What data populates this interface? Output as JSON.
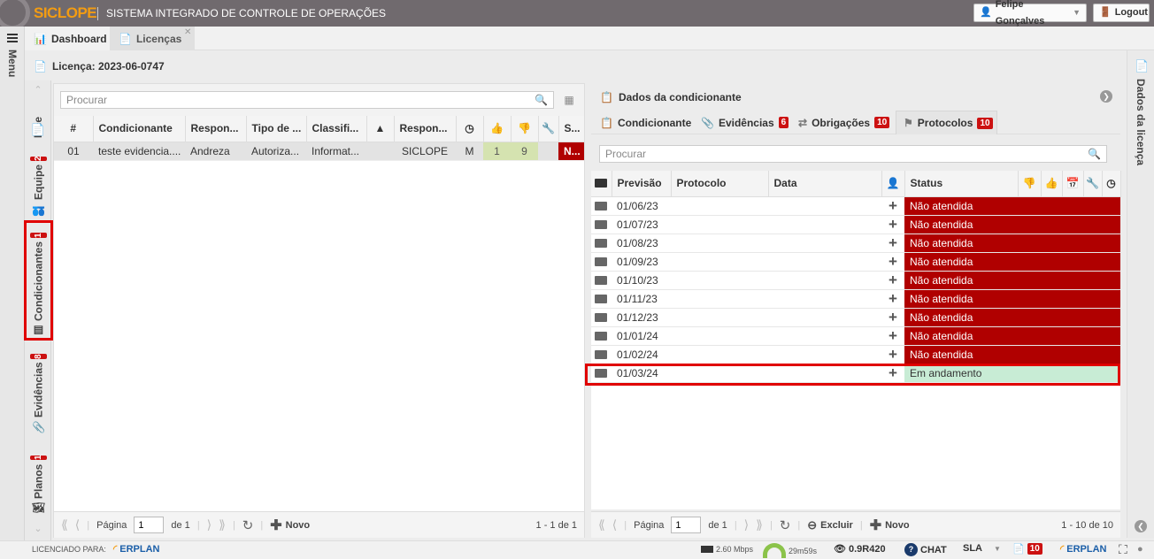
{
  "app": {
    "logo": "SICLOPE",
    "title": "SISTEMA INTEGRADO DE CONTROLE DE OPERAÇÕES"
  },
  "user": {
    "name": "Felipe Gonçalves",
    "logout": "Logout"
  },
  "tabs": {
    "dashboard": "Dashboard",
    "licencas": "Licenças"
  },
  "menu": {
    "label": "Menu"
  },
  "page": {
    "title": "Licença: 2023-06-0747"
  },
  "left_tabs": {
    "lice": "Lice",
    "equipe": "Equipe",
    "equipe_badge": "2",
    "condicionantes": "Condicionantes",
    "condicionantes_badge": "1",
    "evidencias": "Evidências",
    "evidencias_badge": "8",
    "planos": "Planos",
    "planos_badge": "1"
  },
  "left": {
    "search_placeholder": "Procurar",
    "columns": [
      "#",
      "Condicionante",
      "Respon...",
      "Tipo de ...",
      "Classifi...",
      "",
      "Respon...",
      "",
      "",
      "",
      "",
      "S..."
    ],
    "rows": [
      {
        "num": "01",
        "condicionante": "teste evidencia....",
        "responsavel": "Andreza",
        "tipo": "Autoriza...",
        "classificacao": "Informat...",
        "resp2": "SICLOPE",
        "freq": "M",
        "likes": "1",
        "dislikes": "9",
        "status": "N..."
      }
    ],
    "pager": {
      "pagina": "Página",
      "page": "1",
      "de": "de 1",
      "novo": "Novo",
      "range": "1 - 1 de 1"
    }
  },
  "right": {
    "header": "Dados da condicionante",
    "tabs": {
      "condicionante": "Condicionante",
      "evidencias": "Evidências",
      "evidencias_badge": "6",
      "obrigacoes": "Obrigações",
      "obrigacoes_badge": "10",
      "protocolos": "Protocolos",
      "protocolos_badge": "10"
    },
    "search_placeholder": "Procurar",
    "columns": {
      "previsao": "Previsão",
      "protocolo": "Protocolo",
      "data": "Data",
      "status": "Status"
    },
    "rows": [
      {
        "previsao": "01/06/23",
        "status": "Não atendida"
      },
      {
        "previsao": "01/07/23",
        "status": "Não atendida"
      },
      {
        "previsao": "01/08/23",
        "status": "Não atendida"
      },
      {
        "previsao": "01/09/23",
        "status": "Não atendida"
      },
      {
        "previsao": "01/10/23",
        "status": "Não atendida"
      },
      {
        "previsao": "01/11/23",
        "status": "Não atendida"
      },
      {
        "previsao": "01/12/23",
        "status": "Não atendida"
      },
      {
        "previsao": "01/01/24",
        "status": "Não atendida"
      },
      {
        "previsao": "01/02/24",
        "status": "Não atendida"
      },
      {
        "previsao": "01/03/24",
        "status": "Em andamento"
      }
    ],
    "pager": {
      "pagina": "Página",
      "page": "1",
      "de": "de 1",
      "excluir": "Excluir",
      "novo": "Novo",
      "range": "1 - 10 de 10"
    },
    "side_label": "Dados da licença"
  },
  "footer": {
    "licenciado": "LICENCIADO PARA:",
    "brand": "ERPLAN",
    "speed": "2.60 Mbps",
    "timer": "29m59s",
    "version": "0.9R420",
    "chat": "CHAT",
    "sla": "SLA",
    "sla_badge": "10",
    "brand2": "ERPLAN"
  },
  "colors": {
    "accent_red": "#b00000",
    "green": "#c8ecd5",
    "logo": "#f39c12",
    "topbar": "#706a6e"
  }
}
